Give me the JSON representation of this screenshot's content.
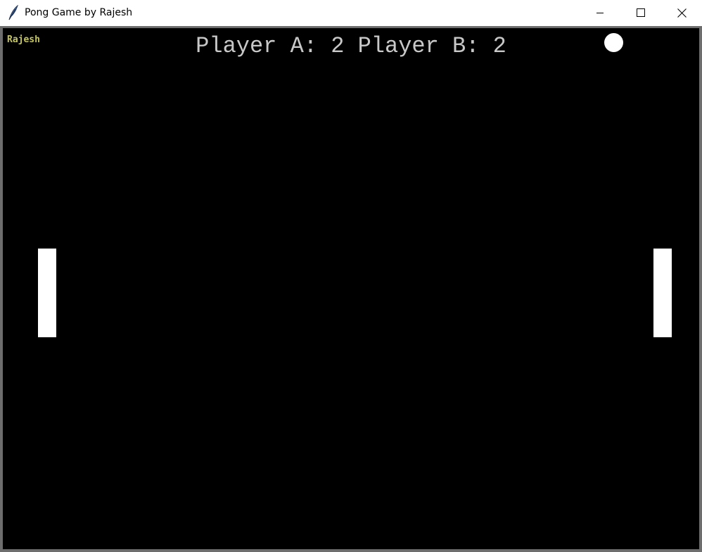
{
  "window": {
    "title": "Pong Game by Rajesh",
    "icon": "feather-icon",
    "controls": {
      "minimize_icon": "minimize-icon",
      "maximize_icon": "maximize-icon",
      "close_icon": "close-icon"
    }
  },
  "game": {
    "author_label": "Rajesh",
    "scoreboard": {
      "text": "Player A: 2 Player B: 2",
      "player_a_score": 2,
      "player_b_score": 2
    },
    "colors": {
      "background": "#000000",
      "paddle": "#ffffff",
      "ball": "#ffffff",
      "score_text": "#c8c8c8",
      "author_text": "#c6c65a"
    }
  }
}
